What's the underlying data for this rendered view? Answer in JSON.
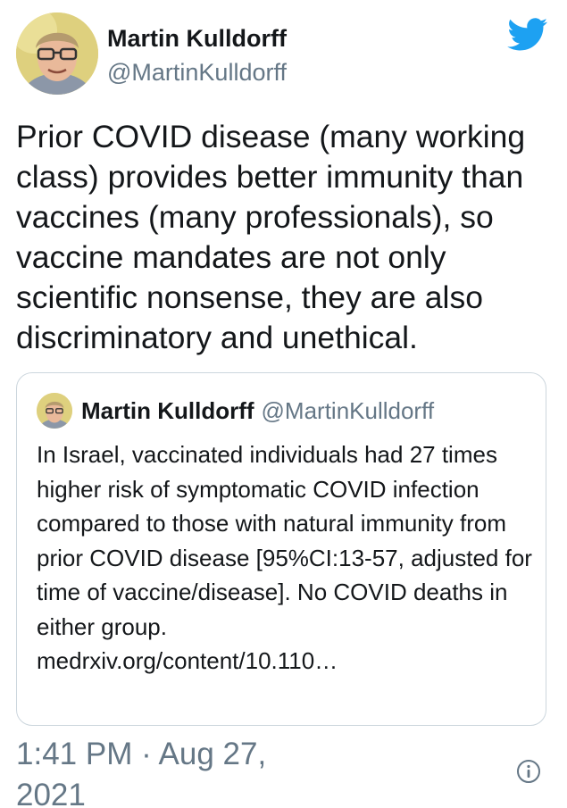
{
  "author": {
    "name": "Martin Kulldorff",
    "handle": "@MartinKulldorff",
    "avatar_icon": "profile-photo"
  },
  "brand": {
    "logo_icon": "twitter-bird-icon",
    "color": "#1DA1F2"
  },
  "tweet": {
    "text": "Prior COVID disease (many working class) provides better immunity than vaccines (many professionals), so vaccine mandates are not only scientific nonsense, they are also discriminatory and unethical."
  },
  "quoted_tweet": {
    "name": "Martin Kulldorff",
    "handle": "@MartinKulldorff",
    "text": "In Israel, vaccinated individuals had 27 times higher risk of symptomatic COVID infection compared to those with natural immunity from prior COVID disease [95%CI:13-57, adjusted for time of vaccine/disease]. No COVID deaths in either group.",
    "link": "medrxiv.org/content/10.110…"
  },
  "meta": {
    "timestamp": "1:41 PM · Aug 27, 2021",
    "info_icon": "info-icon"
  },
  "colors": {
    "text_primary": "#14171a",
    "text_secondary": "#657786",
    "border": "#ccd6dd"
  }
}
